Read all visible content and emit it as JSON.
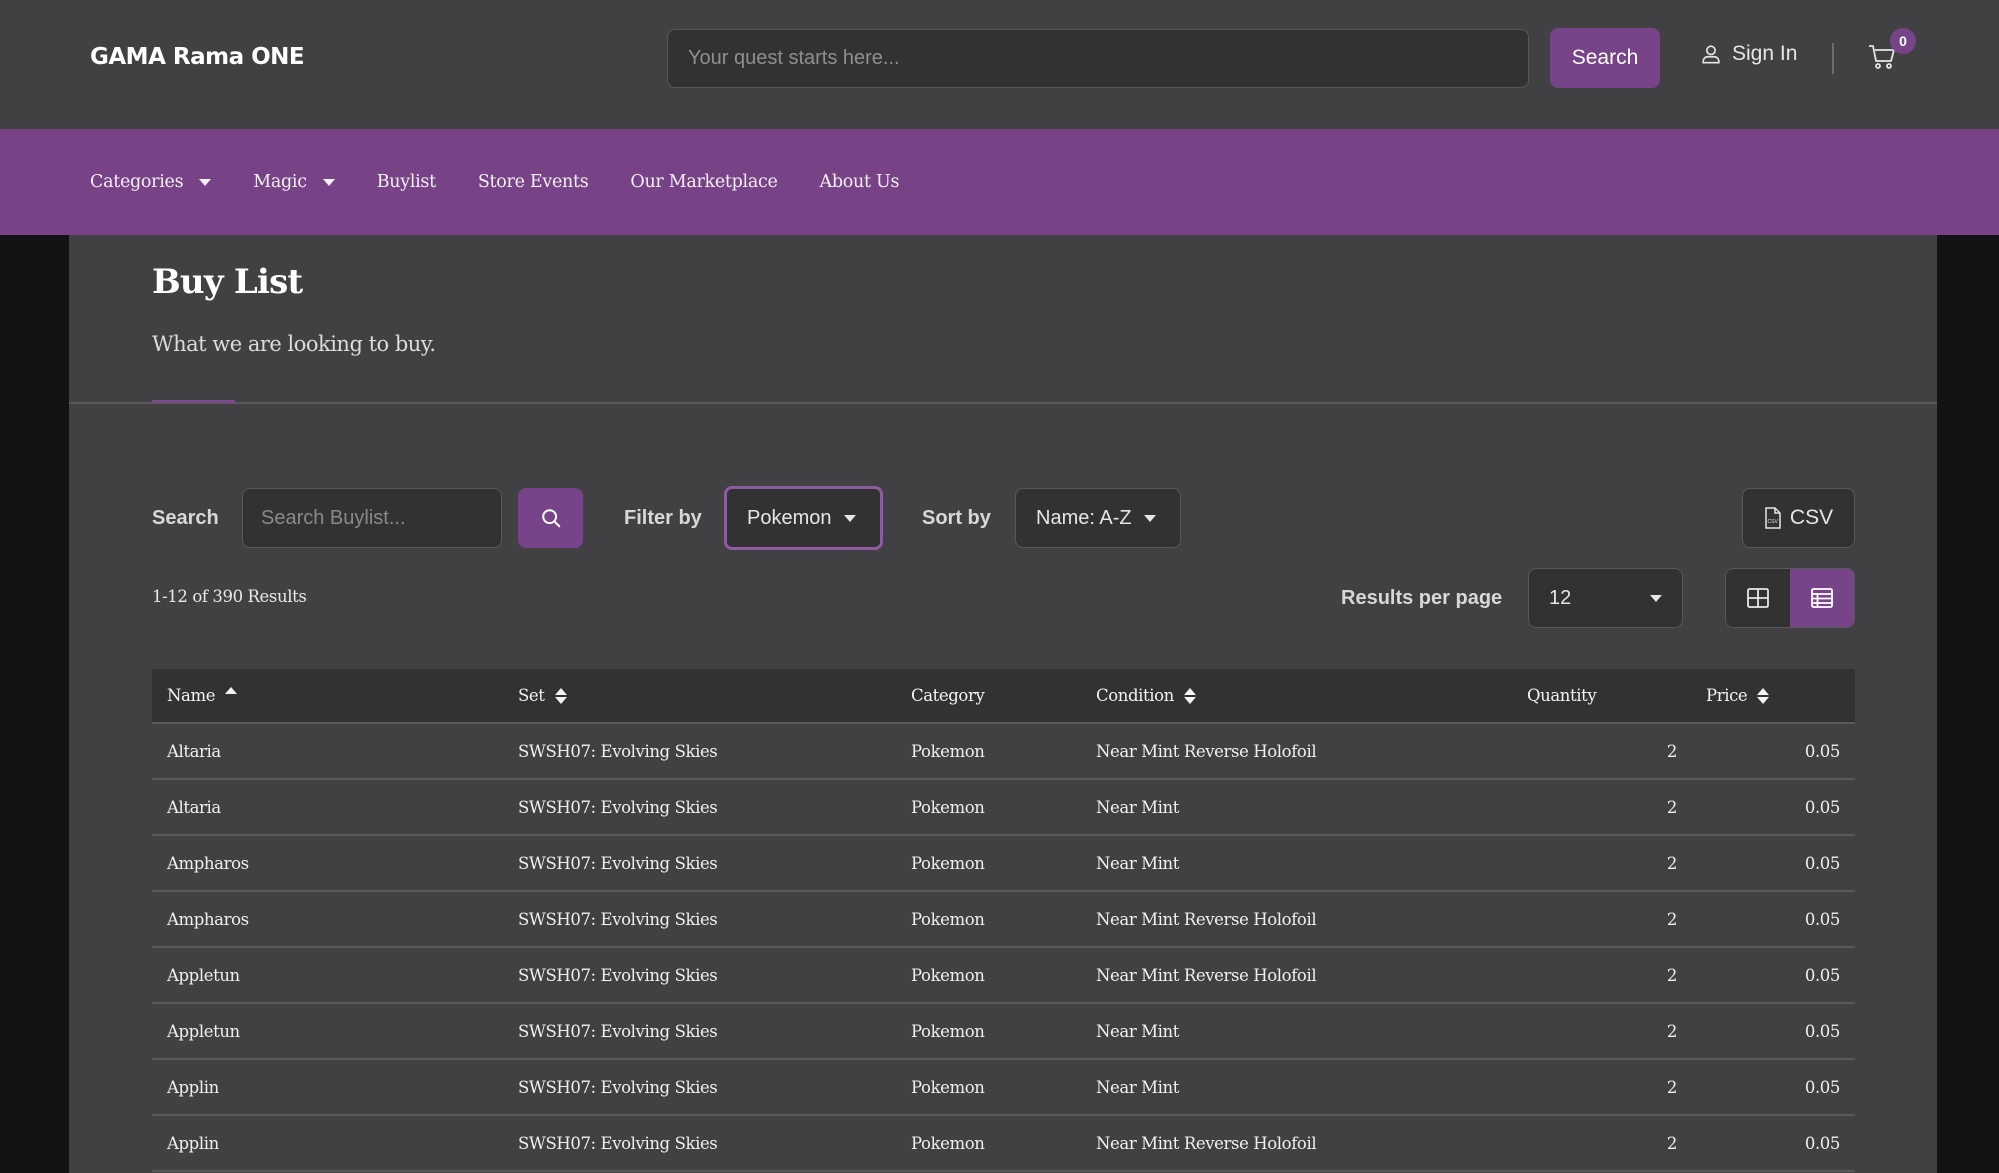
{
  "header": {
    "logo": "GAMA Rama ONE",
    "search_placeholder": "Your quest starts here...",
    "search_button": "Search",
    "sign_in": "Sign In",
    "cart_count": "0"
  },
  "nav": {
    "items": [
      {
        "label": "Categories",
        "dropdown": true
      },
      {
        "label": "Magic",
        "dropdown": true
      },
      {
        "label": "Buylist",
        "dropdown": false
      },
      {
        "label": "Store Events",
        "dropdown": false
      },
      {
        "label": "Our Marketplace",
        "dropdown": false
      },
      {
        "label": "About Us",
        "dropdown": false
      }
    ]
  },
  "page": {
    "title": "Buy List",
    "subtitle": "What we are looking to buy."
  },
  "controls": {
    "search_label": "Search",
    "search_placeholder": "Search Buylist...",
    "filter_label": "Filter by",
    "filter_value": "Pokemon",
    "sort_label": "Sort by",
    "sort_value": "Name: A-Z",
    "csv_label": "CSV",
    "results_count": "1-12 of 390 Results",
    "per_page_label": "Results per page",
    "per_page_value": "12",
    "view_mode": "list"
  },
  "table": {
    "columns": {
      "name": "Name",
      "set": "Set",
      "category": "Category",
      "condition": "Condition",
      "quantity": "Quantity",
      "price": "Price"
    },
    "sort": {
      "column": "name",
      "direction": "asc"
    },
    "rows": [
      {
        "name": "Altaria",
        "set": "SWSH07: Evolving Skies",
        "category": "Pokemon",
        "condition": "Near Mint Reverse Holofoil",
        "quantity": "2",
        "price": "0.05"
      },
      {
        "name": "Altaria",
        "set": "SWSH07: Evolving Skies",
        "category": "Pokemon",
        "condition": "Near Mint",
        "quantity": "2",
        "price": "0.05"
      },
      {
        "name": "Ampharos",
        "set": "SWSH07: Evolving Skies",
        "category": "Pokemon",
        "condition": "Near Mint",
        "quantity": "2",
        "price": "0.05"
      },
      {
        "name": "Ampharos",
        "set": "SWSH07: Evolving Skies",
        "category": "Pokemon",
        "condition": "Near Mint Reverse Holofoil",
        "quantity": "2",
        "price": "0.05"
      },
      {
        "name": "Appletun",
        "set": "SWSH07: Evolving Skies",
        "category": "Pokemon",
        "condition": "Near Mint Reverse Holofoil",
        "quantity": "2",
        "price": "0.05"
      },
      {
        "name": "Appletun",
        "set": "SWSH07: Evolving Skies",
        "category": "Pokemon",
        "condition": "Near Mint",
        "quantity": "2",
        "price": "0.05"
      },
      {
        "name": "Applin",
        "set": "SWSH07: Evolving Skies",
        "category": "Pokemon",
        "condition": "Near Mint",
        "quantity": "2",
        "price": "0.05"
      },
      {
        "name": "Applin",
        "set": "SWSH07: Evolving Skies",
        "category": "Pokemon",
        "condition": "Near Mint Reverse Holofoil",
        "quantity": "2",
        "price": "0.05"
      }
    ]
  },
  "colors": {
    "accent": "#784489",
    "nav_bg": "#774286",
    "header_bg": "#414043",
    "panel_bg": "#414043",
    "input_bg": "#323232",
    "page_bg": "#131313"
  }
}
